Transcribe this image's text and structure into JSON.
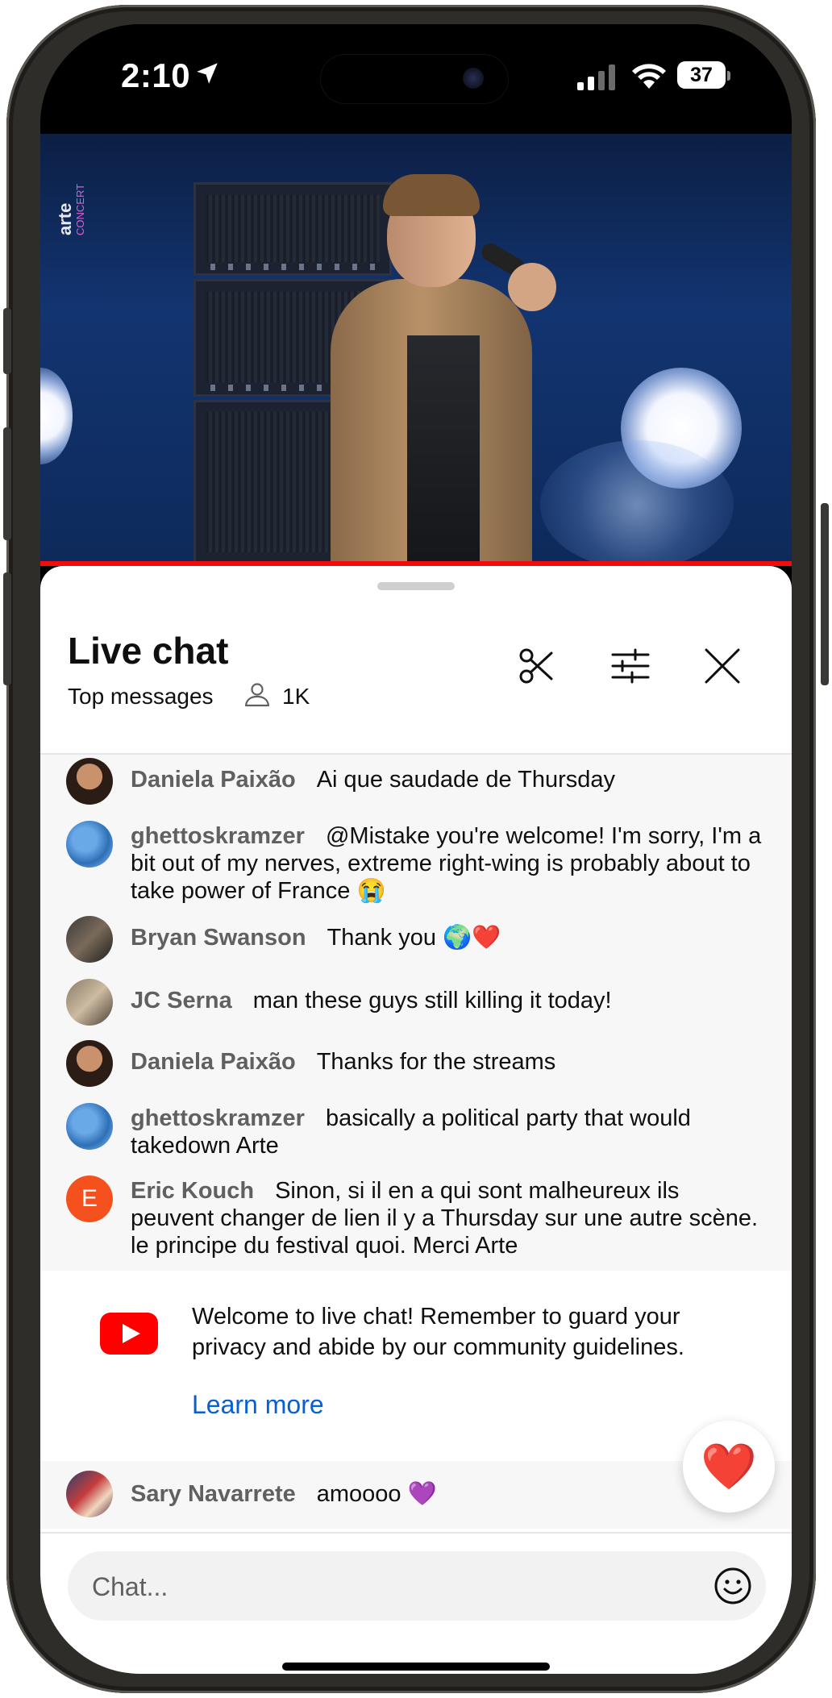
{
  "status_bar": {
    "time": "2:10",
    "battery": "37"
  },
  "video": {
    "channel_watermark_top": "arte",
    "channel_watermark_bottom": "CONCERT"
  },
  "chat": {
    "title": "Live chat",
    "mode": "Top messages",
    "viewer_count": "1K",
    "messages": [
      {
        "author": "Daniela Paixão",
        "text": "Ai que saudade de Thursday"
      },
      {
        "author": "ghettoskramzer",
        "text": "@Mistake you're welcome! I'm sorry, I'm a bit out of my nerves, extreme right-wing is probably about to take power of France 😭"
      },
      {
        "author": "Bryan Swanson",
        "text": "Thank you 🌍❤️"
      },
      {
        "author": "JC Serna",
        "text": "man these guys still killing it today!"
      },
      {
        "author": "Daniela Paixão",
        "text": "Thanks for the streams"
      },
      {
        "author": "ghettoskramzer",
        "text": "basically a political party that would takedown Arte"
      },
      {
        "author": "Eric Kouch",
        "avatar_letter": "E",
        "text": "Sinon, si il en a qui sont malheureux ils peuvent changer de lien il y a Thursday sur une autre scène. le principe du festival quoi. Merci Arte"
      }
    ],
    "welcome": {
      "text": "Welcome to live chat! Remember to guard your privacy and abide by our community guidelines.",
      "learn_more": "Learn more"
    },
    "pinned": {
      "author": "Sary Navarrete",
      "text": "amoooo 💜"
    },
    "reaction": "❤️",
    "input_placeholder": "Chat..."
  },
  "colors": {
    "accent_red": "#f20c0c",
    "link_blue": "#065fd4",
    "eric_avatar": "#f4511e"
  }
}
